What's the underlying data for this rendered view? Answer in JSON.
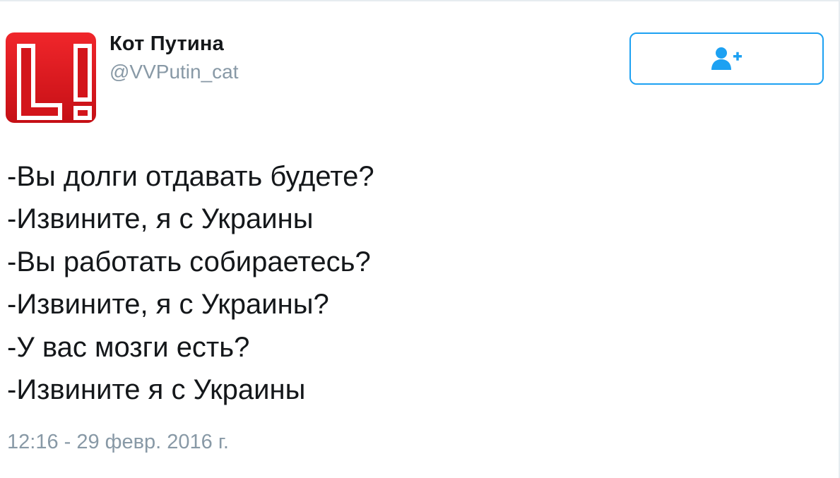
{
  "tweet": {
    "author": {
      "display_name": "Кот Путина",
      "handle": "@VVPutin_cat",
      "avatar_text": "L!"
    },
    "follow_button": {
      "icon": "follow-user-plus-icon"
    },
    "lines": [
      "-Вы долги отдавать будете?",
      "-Извините, я с Украины",
      "-Вы работать собираетесь?",
      "-Извините, я с Украины?",
      "-У вас мозги есть?",
      "-Извините я с Украины"
    ],
    "timestamp": "12:16 - 29 февр. 2016 г."
  },
  "colors": {
    "accent": "#1da1f2",
    "avatar_red": "#d3151b",
    "secondary_text": "#8899a6",
    "primary_text": "#14171a",
    "border": "#e6ecf0"
  }
}
